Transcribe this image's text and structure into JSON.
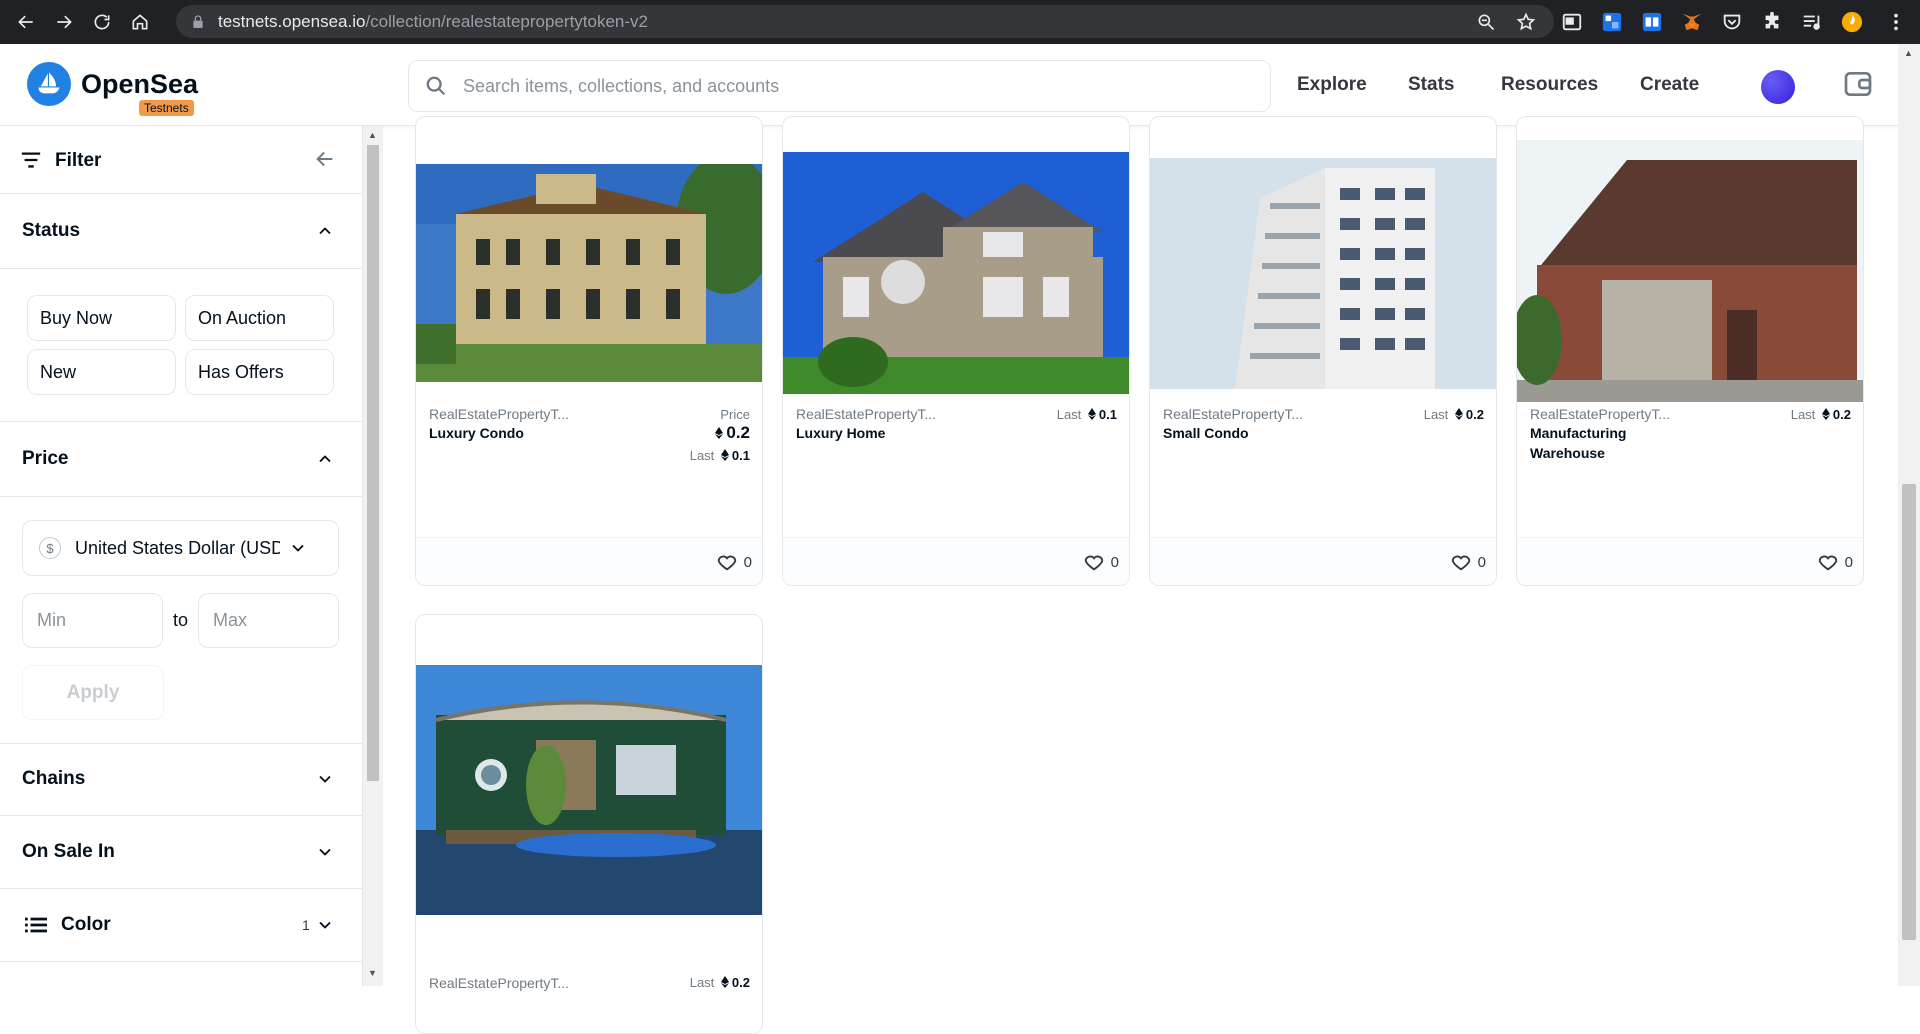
{
  "browser": {
    "url_host": "testnets.opensea.io",
    "url_path": "/collection/realestatepropertytoken-v2"
  },
  "header": {
    "logo_text": "OpenSea",
    "badge": "Testnets",
    "search_placeholder": "Search items, collections, and accounts",
    "nav": [
      "Explore",
      "Stats",
      "Resources",
      "Create"
    ]
  },
  "sidebar": {
    "filter_label": "Filter",
    "status_title": "Status",
    "status_chips": [
      "Buy Now",
      "On Auction",
      "New",
      "Has Offers"
    ],
    "price_title": "Price",
    "currency": "United States Dollar (USD)",
    "currency_symbol": "$",
    "min_placeholder": "Min",
    "to_label": "to",
    "max_placeholder": "Max",
    "apply_label": "Apply",
    "chains_title": "Chains",
    "onsale_title": "On Sale In",
    "color_title": "Color",
    "color_count": "1"
  },
  "cards": [
    {
      "collection": "RealEstatePropertyT...",
      "name": "Luxury Condo",
      "price_label": "Price",
      "price": "0.2",
      "last_label": "Last",
      "last": "0.1",
      "likes": "0",
      "image": "yellow-victorian-house"
    },
    {
      "collection": "RealEstatePropertyT...",
      "name": "Luxury Home",
      "last_label": "Last",
      "last": "0.1",
      "likes": "0",
      "image": "two-story-suburban-home"
    },
    {
      "collection": "RealEstatePropertyT...",
      "name": "Small Condo",
      "last_label": "Last",
      "last": "0.2",
      "likes": "0",
      "image": "highrise-condo-tower"
    },
    {
      "collection": "RealEstatePropertyT...",
      "name": "Manufacturing Warehouse",
      "last_label": "Last",
      "last": "0.2",
      "likes": "0",
      "image": "brick-warehouse"
    },
    {
      "collection": "RealEstatePropertyT...",
      "name": "",
      "last_label": "Last",
      "last": "0.2",
      "likes": "",
      "image": "green-houseboat"
    }
  ]
}
